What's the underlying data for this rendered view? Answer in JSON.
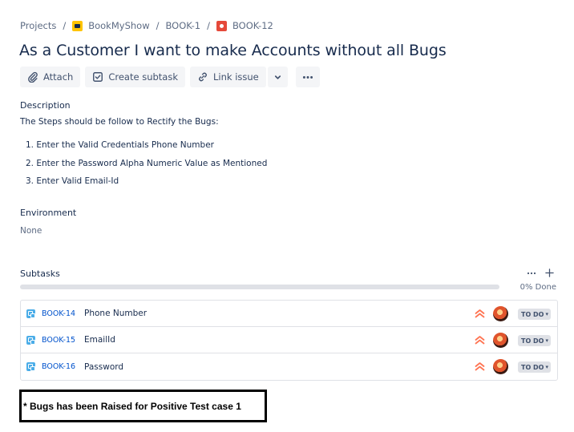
{
  "breadcrumb": {
    "projects": "Projects",
    "separator": "/",
    "project_name": "BookMyShow",
    "parent_key": "BOOK-1",
    "issue_key": "BOOK-12"
  },
  "issue": {
    "title": "As a Customer I want to make Accounts without all Bugs"
  },
  "toolbar": {
    "attach_label": "Attach",
    "create_subtask_label": "Create subtask",
    "link_issue_label": "Link issue"
  },
  "description": {
    "label": "Description",
    "intro": "The Steps should be  follow to Rectify the Bugs:",
    "steps": [
      "1. Enter the Valid Credentials Phone Number",
      "2. Enter the Password Alpha Numeric Value as Mentioned",
      "3. Enter Valid Email-Id"
    ]
  },
  "environment": {
    "label": "Environment",
    "value": "None"
  },
  "subtasks": {
    "label": "Subtasks",
    "progress_text": "0% Done",
    "progress_fraction": 0,
    "items": [
      {
        "key": "BOOK-14",
        "summary": "Phone Number",
        "status": "TO DO"
      },
      {
        "key": "BOOK-15",
        "summary": "EmailId",
        "status": "TO DO"
      },
      {
        "key": "BOOK-16",
        "summary": "Password",
        "status": "TO DO"
      }
    ]
  },
  "note": {
    "text": "* Bugs has been Raised for Positive Test case 1"
  },
  "colors": {
    "link": "#0052cc",
    "priority": "#ff7452",
    "subtask_icon": "#4bade8",
    "progress_track": "#dfe1e6"
  },
  "icons": {
    "attach": "paperclip-icon",
    "create_subtask": "checkbox-icon",
    "link_issue": "link-icon",
    "priority": "priority-high-icon"
  }
}
